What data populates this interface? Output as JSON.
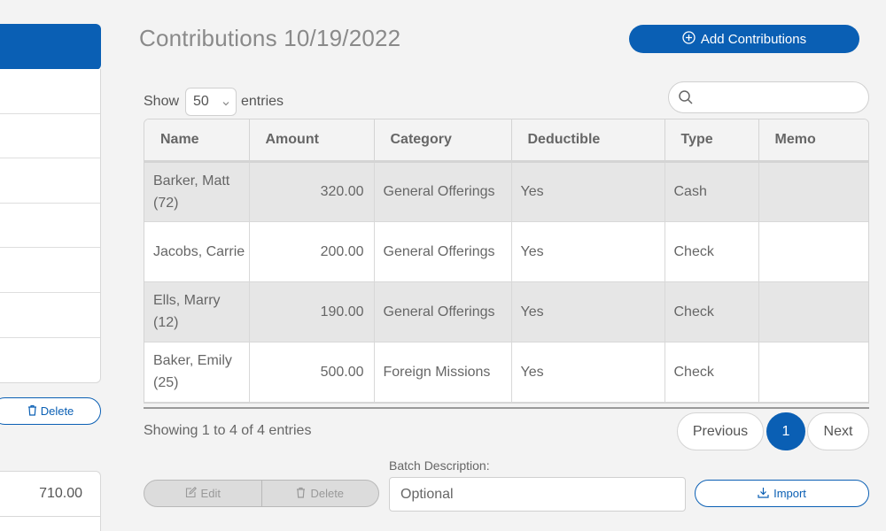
{
  "page": {
    "title": "Contributions 10/19/2022",
    "add_button_label": "Add Contributions"
  },
  "left_panel": {
    "delete_label": "Delete",
    "total_value": "710.00"
  },
  "controls": {
    "show_label": "Show",
    "entries_value": "50",
    "entries_label": "entries",
    "search_placeholder": ""
  },
  "table": {
    "headers": [
      "Name",
      "Amount",
      "Category",
      "Deductible",
      "Type",
      "Memo"
    ],
    "rows": [
      {
        "name": "Barker, Matt (72)",
        "amount": "320.00",
        "category": "General Offerings",
        "deductible": "Yes",
        "type": "Cash",
        "memo": ""
      },
      {
        "name": "Jacobs, Carrie",
        "amount": "200.00",
        "category": "General Offerings",
        "deductible": "Yes",
        "type": "Check",
        "memo": ""
      },
      {
        "name": "Ells, Marry (12)",
        "amount": "190.00",
        "category": "General Offerings",
        "deductible": "Yes",
        "type": "Check",
        "memo": ""
      },
      {
        "name": "Baker, Emily (25)",
        "amount": "500.00",
        "category": "Foreign Missions",
        "deductible": "Yes",
        "type": "Check",
        "memo": ""
      }
    ]
  },
  "pagination": {
    "info": "Showing 1 to 4 of 4 entries",
    "previous_label": "Previous",
    "current_page": "1",
    "next_label": "Next"
  },
  "footer": {
    "edit_label": "Edit",
    "delete_label": "Delete",
    "batch_label": "Batch Description:",
    "batch_placeholder": "Optional",
    "import_label": "Import"
  },
  "colors": {
    "accent": "#0a5fb4",
    "row_shade": "#e6e6e6",
    "background": "#f3f3f3"
  }
}
